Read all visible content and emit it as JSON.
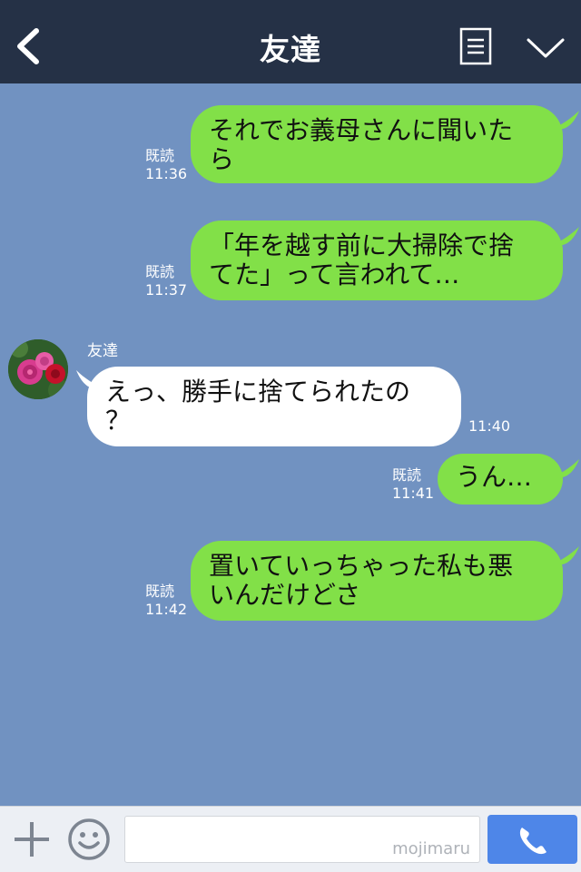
{
  "header": {
    "title": "友達",
    "back_icon": "chevron-left-icon",
    "menu_icon": "notes-icon",
    "dropdown_icon": "chevron-down-icon"
  },
  "messages": [
    {
      "side": "out",
      "text_line1": "それでお義母さんに聞いた",
      "text_line2": "ら",
      "read": "既読",
      "time": "11:36"
    },
    {
      "side": "out",
      "text_line1": "「年を越す前に大掃除で捨",
      "text_line2": "てた」って言われて…",
      "read": "既読",
      "time": "11:37"
    },
    {
      "side": "in",
      "sender": "友達",
      "text_line1": "えっ、勝手に捨てられたの",
      "text_line2": "？",
      "time": "11:40"
    },
    {
      "side": "out",
      "text_line1": "うん…",
      "read": "既読",
      "time": "11:41"
    },
    {
      "side": "out",
      "text_line1": "置いていっちゃった私も悪",
      "text_line2": "いんだけどさ",
      "read": "既読",
      "time": "11:42"
    }
  ],
  "input": {
    "placeholder": "",
    "watermark": "mojimaru"
  },
  "toolbar": {
    "plus_icon": "plus-icon",
    "emoji_icon": "smiley-icon",
    "call_icon": "phone-icon"
  },
  "colors": {
    "header_bg": "#253146",
    "chat_bg": "#7192c1",
    "outgoing_bubble": "#82e048",
    "incoming_bubble": "#ffffff",
    "call_button": "#4e86e8"
  }
}
